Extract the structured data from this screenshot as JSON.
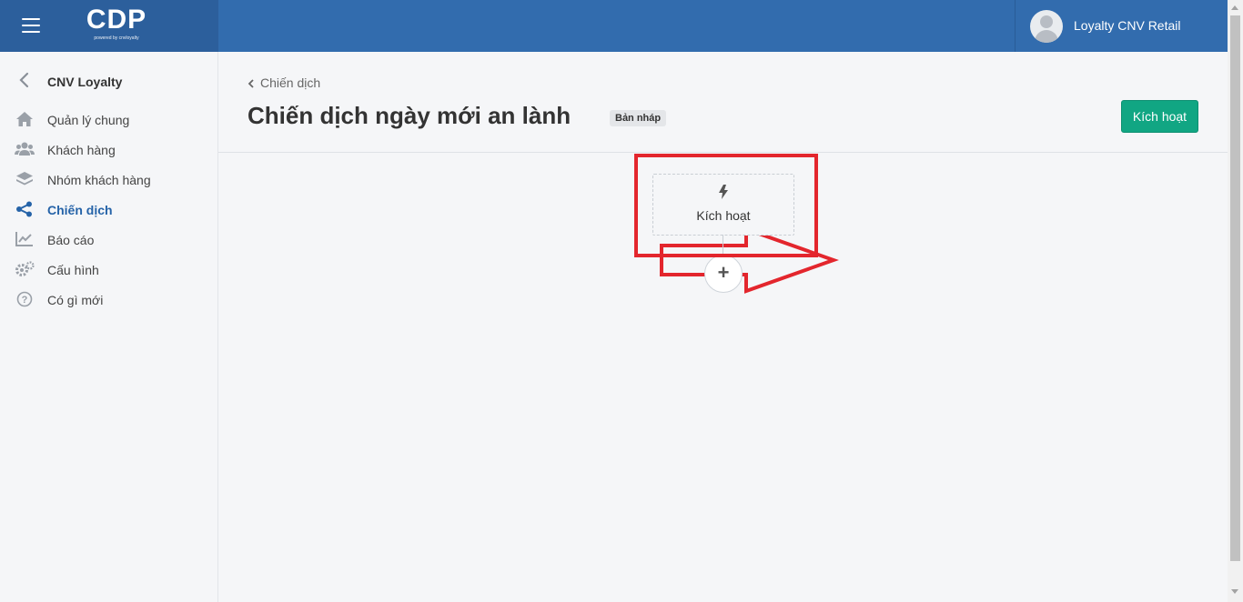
{
  "brand": {
    "logo_text": "CDP",
    "logo_sub": "powered by cnvloyalty"
  },
  "user": {
    "name": "Loyalty CNV Retail"
  },
  "sidebar": {
    "title": "CNV Loyalty",
    "items": [
      {
        "label": "Quản lý chung",
        "icon": "home-icon"
      },
      {
        "label": "Khách hàng",
        "icon": "users-icon"
      },
      {
        "label": "Nhóm khách hàng",
        "icon": "layers-icon"
      },
      {
        "label": "Chiến dịch",
        "icon": "share-icon",
        "active": true
      },
      {
        "label": "Báo cáo",
        "icon": "chart-line-icon"
      },
      {
        "label": "Cấu hình",
        "icon": "gears-icon"
      },
      {
        "label": "Có gì mới",
        "icon": "question-circle-icon"
      }
    ]
  },
  "main": {
    "breadcrumb": "Chiến dịch",
    "title": "Chiến dịch ngày mới an lành",
    "status_badge": "Bản nháp",
    "activate_button": "Kích hoạt",
    "flow": {
      "trigger_label": "Kích hoạt",
      "add_symbol": "+"
    }
  },
  "colors": {
    "topbar": "#326cae",
    "accent": "#2563a8",
    "button": "#11a683",
    "annotation": "#e3262d"
  }
}
